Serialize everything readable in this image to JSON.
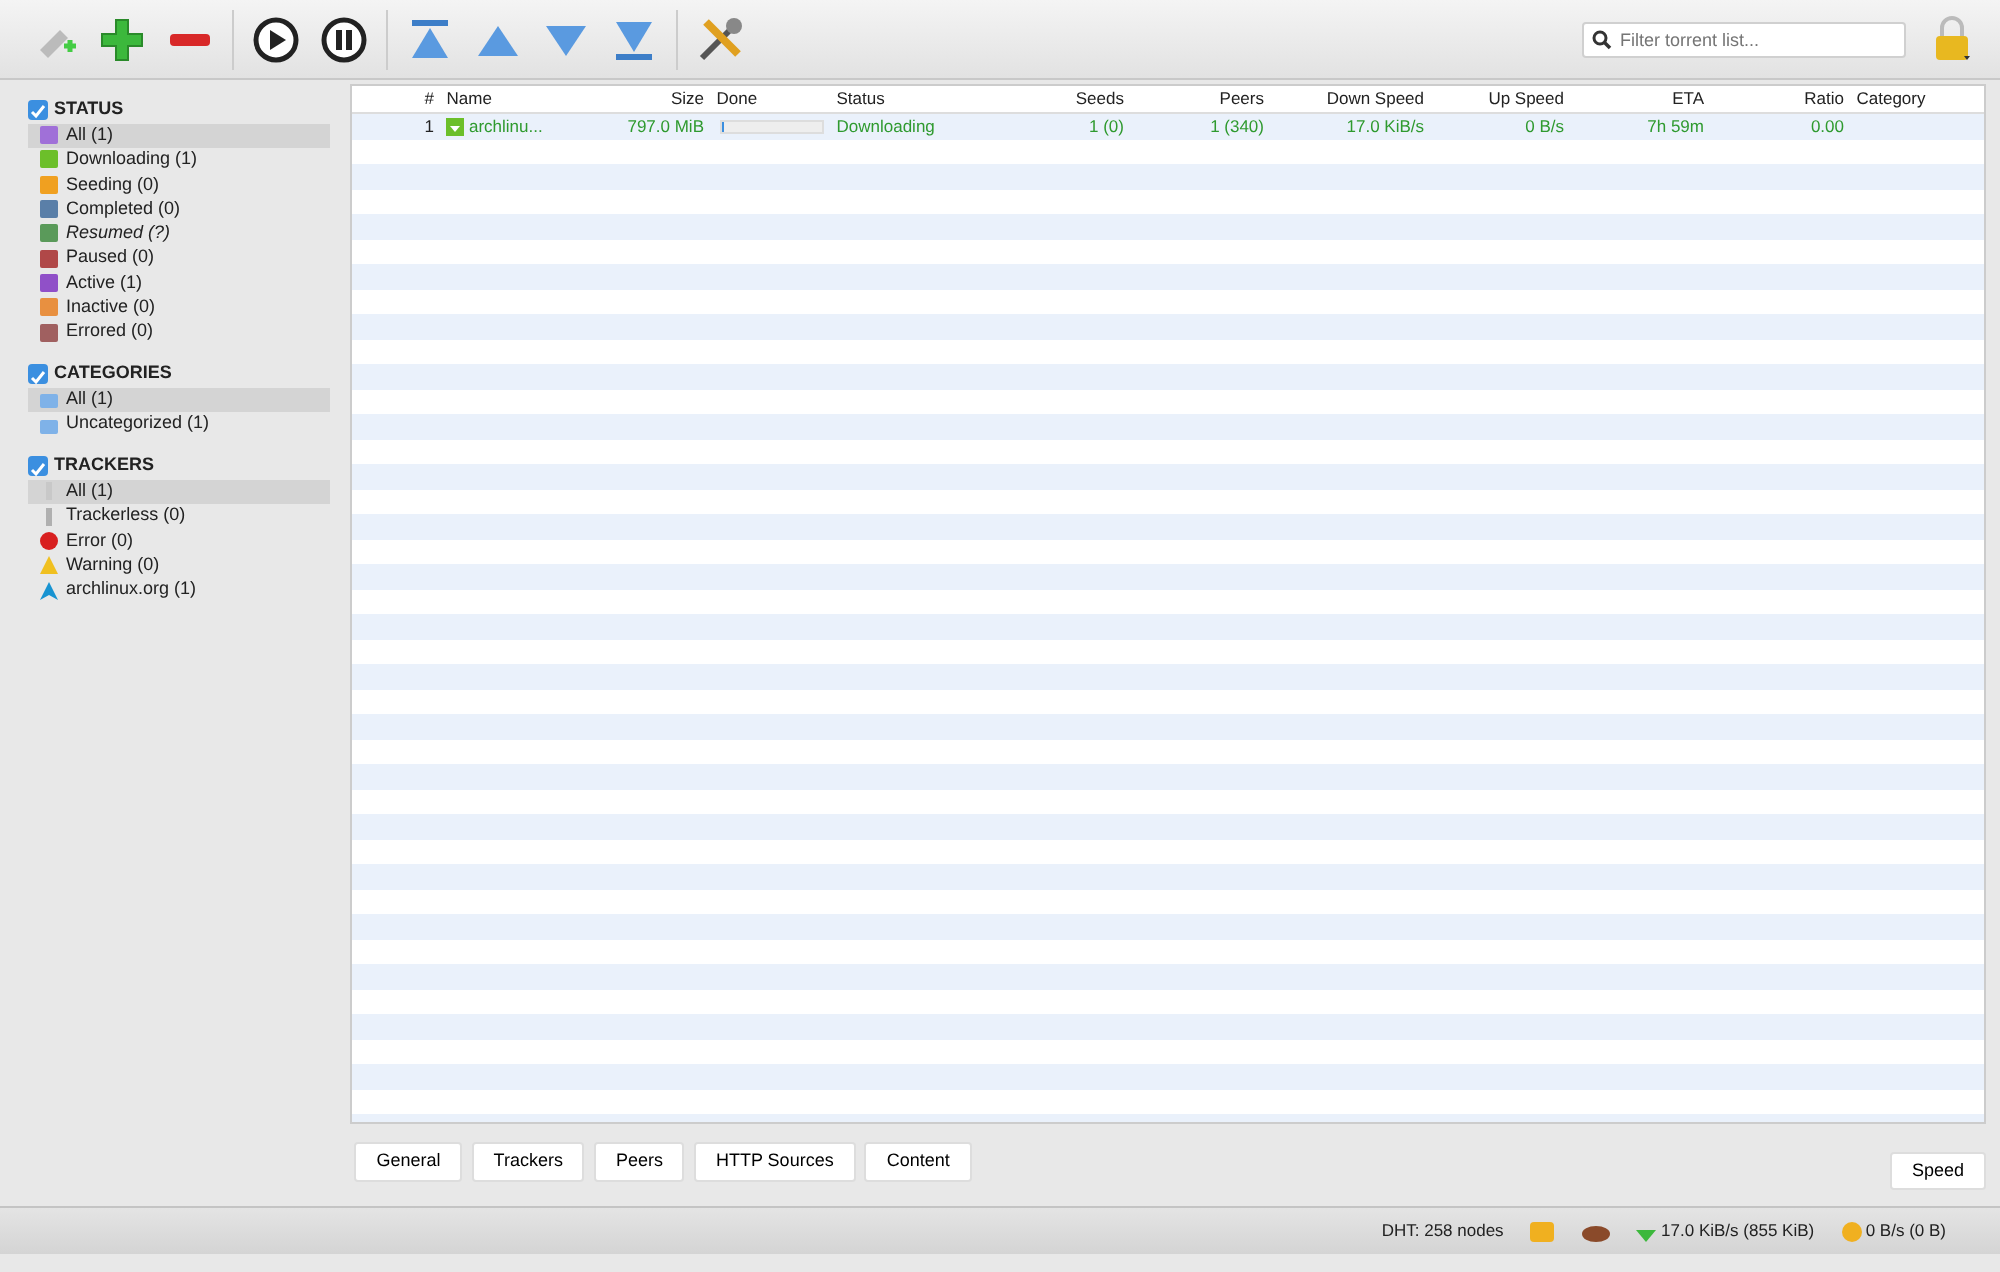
{
  "toolbar": {
    "search": {
      "placeholder": "Filter torrent list..."
    }
  },
  "sidebar": {
    "groups": [
      {
        "title": "STATUS",
        "checked": true,
        "items": [
          {
            "label": "All (1)",
            "selected": true,
            "italic": false,
            "kind": "square",
            "color": "#a070d8"
          },
          {
            "label": "Downloading (1)",
            "selected": false,
            "italic": false,
            "kind": "square",
            "color": "#6cbf2a"
          },
          {
            "label": "Seeding (0)",
            "selected": false,
            "italic": false,
            "kind": "square",
            "color": "#f0a020"
          },
          {
            "label": "Completed (0)",
            "selected": false,
            "italic": false,
            "kind": "square",
            "color": "#5a7fa8"
          },
          {
            "label": "Resumed (?)",
            "selected": false,
            "italic": true,
            "kind": "square",
            "color": "#5a9a5a"
          },
          {
            "label": "Paused (0)",
            "selected": false,
            "italic": false,
            "kind": "square",
            "color": "#b04848"
          },
          {
            "label": "Active (1)",
            "selected": false,
            "italic": false,
            "kind": "square",
            "color": "#9050c8"
          },
          {
            "label": "Inactive (0)",
            "selected": false,
            "italic": false,
            "kind": "square",
            "color": "#e89040"
          },
          {
            "label": "Errored (0)",
            "selected": false,
            "italic": false,
            "kind": "square",
            "color": "#a06060"
          }
        ]
      },
      {
        "title": "CATEGORIES",
        "checked": true,
        "items": [
          {
            "label": "All (1)",
            "selected": true,
            "italic": false,
            "kind": "folder",
            "color": "#7fb2e8"
          },
          {
            "label": "Uncategorized (1)",
            "selected": false,
            "italic": false,
            "kind": "folder",
            "color": "#7fb2e8"
          }
        ]
      },
      {
        "title": "TRACKERS",
        "checked": true,
        "items": [
          {
            "label": "All (1)",
            "selected": true,
            "italic": false,
            "kind": "bar",
            "color": "#c8c8c8"
          },
          {
            "label": "Trackerless (0)",
            "selected": false,
            "italic": false,
            "kind": "bar",
            "color": "#b0b0b0"
          },
          {
            "label": "Error (0)",
            "selected": false,
            "italic": false,
            "kind": "circle",
            "color": "#d82020"
          },
          {
            "label": "Warning (0)",
            "selected": false,
            "italic": false,
            "kind": "triangle",
            "color": "#f0c020"
          },
          {
            "label": "archlinux.org (1)",
            "selected": false,
            "italic": false,
            "kind": "arch",
            "color": "#1793d1"
          }
        ]
      }
    ]
  },
  "table": {
    "columns": [
      "#",
      "Name",
      "Size",
      "Done",
      "Status",
      "Seeds",
      "Peers",
      "Down Speed",
      "Up Speed",
      "ETA",
      "Ratio",
      "Category"
    ],
    "rows": [
      {
        "cells": [
          "1",
          "archlinu...",
          "797.0 MiB",
          "",
          "Downloading",
          "1 (0)",
          "1 (340)",
          "17.0 KiB/s",
          "0 B/s",
          "7h 59m",
          "0.00",
          ""
        ],
        "level": 0.01
      }
    ]
  },
  "detail_tabs": [
    "General",
    "Trackers",
    "Peers",
    "HTTP Sources",
    "Content"
  ],
  "speed_button": "Speed",
  "status_bar": {
    "dht": "DHT: 258 nodes",
    "download": "17.0 KiB/s (855 KiB)",
    "upload": "0 B/s (0 B)"
  }
}
